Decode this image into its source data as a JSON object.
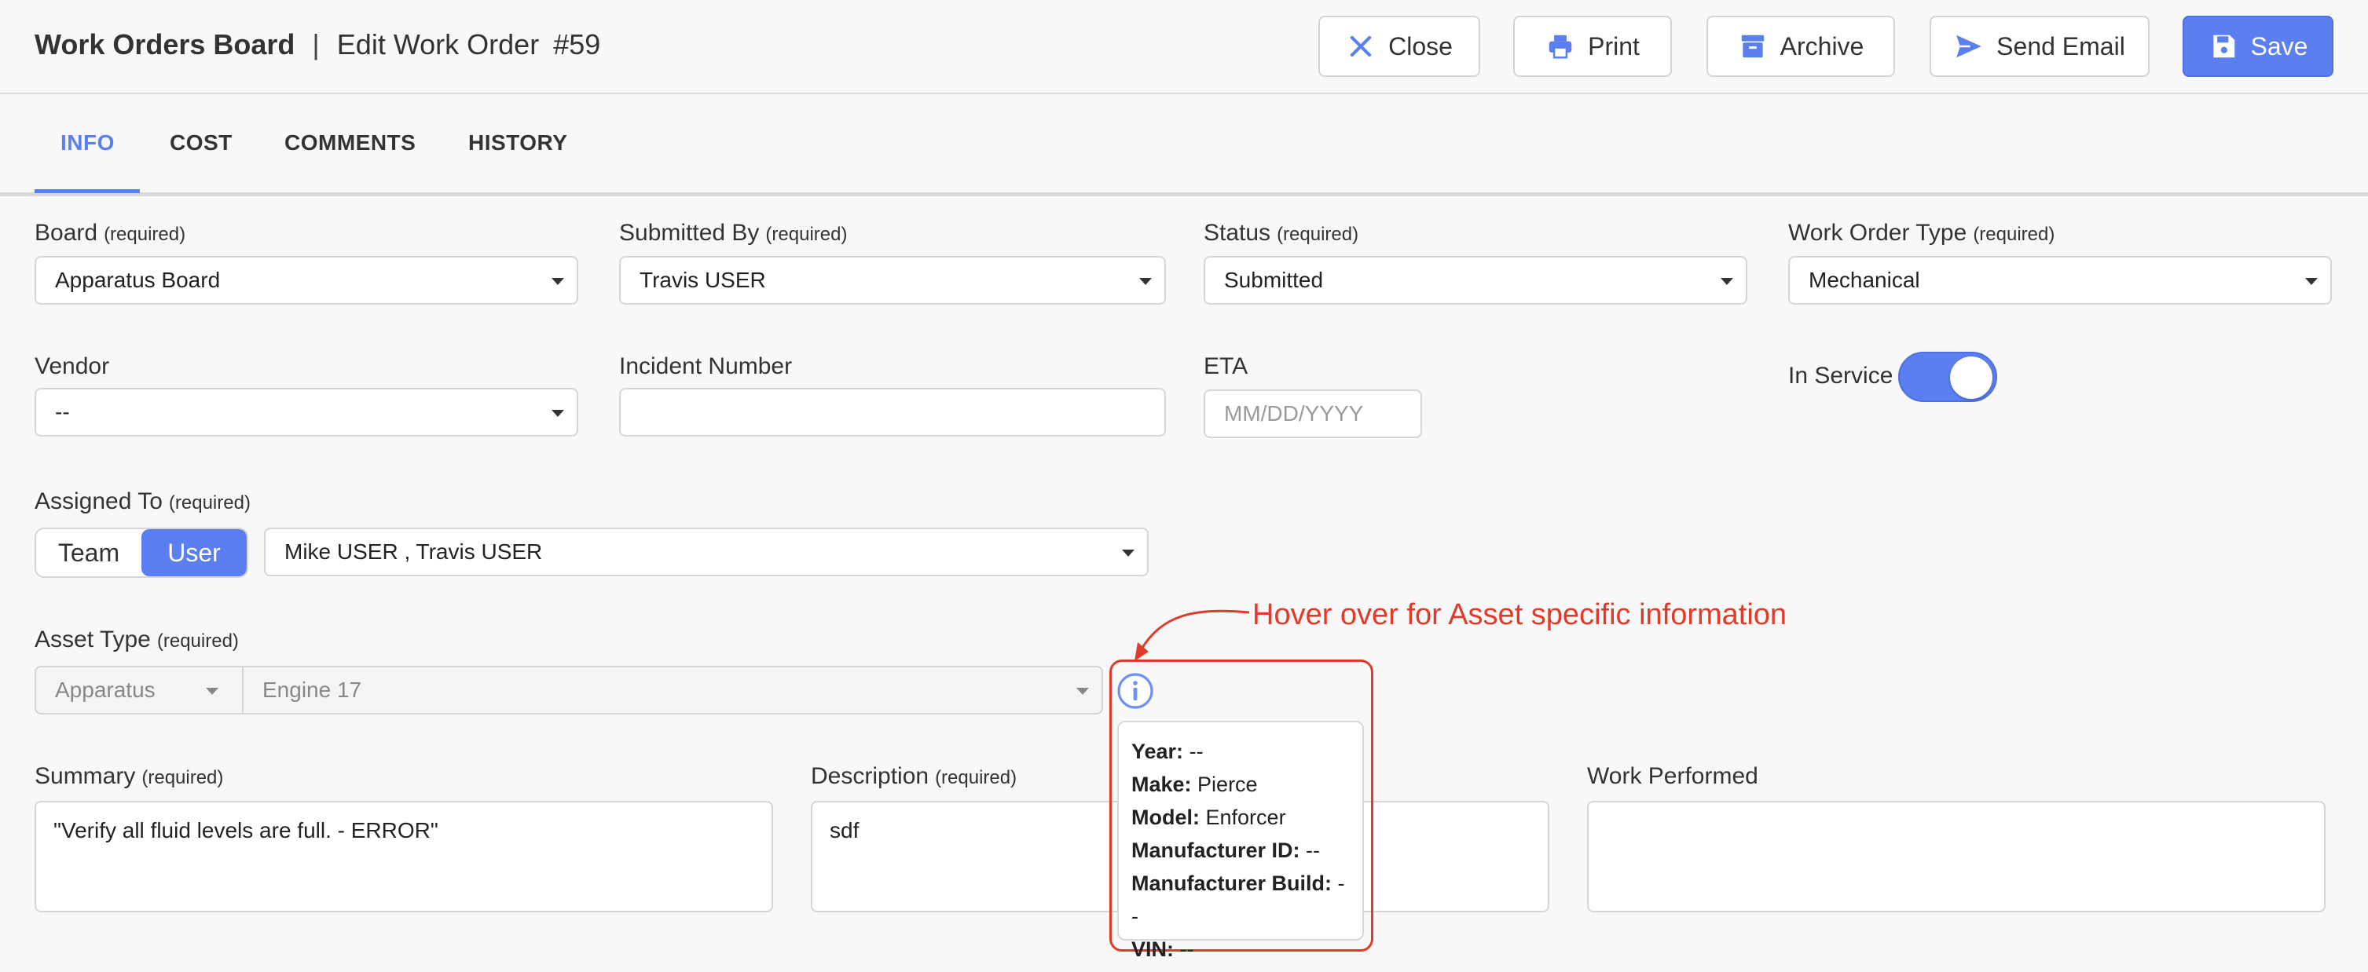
{
  "header": {
    "app_title": "Work Orders Board",
    "separator": "|",
    "page_title": "Edit Work Order",
    "order_number": "#59",
    "buttons": {
      "close": "Close",
      "print": "Print",
      "archive": "Archive",
      "send_email": "Send Email",
      "save": "Save"
    }
  },
  "tabs": [
    {
      "label": "INFO",
      "active": true
    },
    {
      "label": "COST"
    },
    {
      "label": "COMMENTS"
    },
    {
      "label": "HISTORY"
    }
  ],
  "form": {
    "required_text": "(required)",
    "board": {
      "label": "Board",
      "value": "Apparatus Board"
    },
    "submitted_by": {
      "label": "Submitted By",
      "value": "Travis USER"
    },
    "status": {
      "label": "Status",
      "value": "Submitted"
    },
    "work_order_type": {
      "label": "Work Order Type",
      "value": "Mechanical"
    },
    "vendor": {
      "label": "Vendor",
      "value": "--"
    },
    "incident_number": {
      "label": "Incident Number",
      "value": ""
    },
    "eta": {
      "label": "ETA",
      "placeholder": "MM/DD/YYYY"
    },
    "in_service": {
      "label": "In Service",
      "on": true
    },
    "assigned_to": {
      "label": "Assigned To",
      "segments": [
        "Team",
        "User"
      ],
      "selected": "User",
      "value": "Mike USER , Travis USER"
    },
    "asset_type": {
      "label": "Asset Type",
      "category": "Apparatus",
      "asset": "Engine 17"
    },
    "summary": {
      "label": "Summary",
      "value": "\"Verify all fluid levels are full. - ERROR\""
    },
    "description": {
      "label": "Description",
      "value": "sdf"
    },
    "work_performed": {
      "label": "Work Performed",
      "value": ""
    }
  },
  "annotation": {
    "text": "Hover over for Asset specific information",
    "color": "#e23a2a"
  },
  "asset_tooltip": [
    {
      "key": "Year:",
      "value": "--"
    },
    {
      "key": "Make:",
      "value": "Pierce"
    },
    {
      "key": "Model:",
      "value": "Enforcer"
    },
    {
      "key": "Manufacturer ID:",
      "value": "--"
    },
    {
      "key": "Manufacturer Build:",
      "value": "--"
    },
    {
      "key": "VIN:",
      "value": "--"
    }
  ],
  "colors": {
    "accent": "#5b7ff0",
    "annotation": "#e23a2a"
  }
}
